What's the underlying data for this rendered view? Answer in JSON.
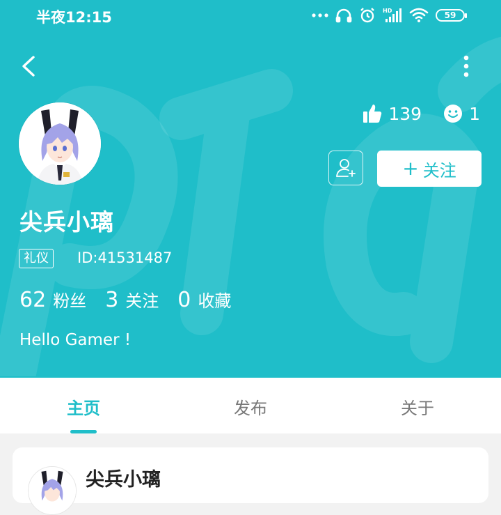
{
  "status_bar": {
    "time": "半夜12:15",
    "battery": "59",
    "icons": [
      "more-dots-icon",
      "headphones-icon",
      "alarm-icon",
      "hd-signal-icon",
      "wifi-icon",
      "battery-icon"
    ]
  },
  "profile": {
    "username": "尖兵小璃",
    "badge": "礼仪",
    "user_id": "ID:41531487",
    "likes": "139",
    "emotes": "1",
    "follow_label": "关注",
    "fans_count": "62",
    "fans_label": "粉丝",
    "following_count": "3",
    "following_label": "关注",
    "favorites_count": "0",
    "favorites_label": "收藏",
    "bio": "Hello Gamer !"
  },
  "tabs": [
    {
      "label": "主页",
      "active": true
    },
    {
      "label": "发布",
      "active": false
    },
    {
      "label": "关于",
      "active": false
    }
  ],
  "post_card": {
    "author": "尖兵小璃"
  },
  "colors": {
    "accent": "#1fbec9",
    "page_background": "#f2f2f2"
  }
}
